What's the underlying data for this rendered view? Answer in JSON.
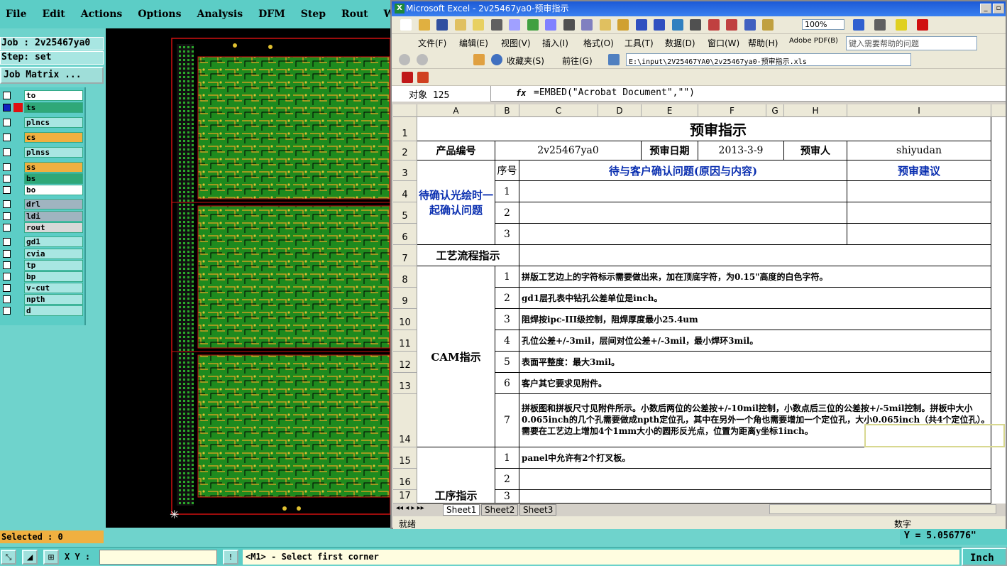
{
  "cam": {
    "menu": [
      "File",
      "Edit",
      "Actions",
      "Options",
      "Analysis",
      "DFM",
      "Step",
      "Rout",
      "Windows"
    ],
    "job": "Job : 2v25467ya0",
    "step": "Step: set",
    "job_matrix": "Job Matrix ...",
    "layers": [
      {
        "name": "to",
        "color": "#ffffff",
        "swatch": ""
      },
      {
        "name": "ts",
        "color": "#2fa878",
        "swatch": "#e01010"
      },
      {
        "name": "plncs",
        "color": "#a8e6e2",
        "swatch": ""
      },
      {
        "name": "cs",
        "color": "#f0b040",
        "swatch": ""
      },
      {
        "name": "plnss",
        "color": "#a8e6e2",
        "swatch": ""
      },
      {
        "name": "ss",
        "color": "#f0b040",
        "swatch": ""
      },
      {
        "name": "bs",
        "color": "#2fa878",
        "swatch": ""
      },
      {
        "name": "bo",
        "color": "#ffffff",
        "swatch": ""
      },
      {
        "name": "drl",
        "color": "#a0b4c0",
        "swatch": ""
      },
      {
        "name": "ldi",
        "color": "#a0b4c0",
        "swatch": ""
      },
      {
        "name": "rout",
        "color": "#d8d8d8",
        "swatch": ""
      },
      {
        "name": "gd1",
        "color": "#a8e6e2",
        "swatch": ""
      },
      {
        "name": "cvia",
        "color": "#a8e6e2",
        "swatch": ""
      },
      {
        "name": "tp",
        "color": "#a8e6e2",
        "swatch": ""
      },
      {
        "name": "bp",
        "color": "#a8e6e2",
        "swatch": ""
      },
      {
        "name": "v-cut",
        "color": "#a8e6e2",
        "swatch": ""
      },
      {
        "name": "npth",
        "color": "#a8e6e2",
        "swatch": ""
      },
      {
        "name": "d",
        "color": "#a8e6e2",
        "swatch": ""
      }
    ],
    "selected": "Selected : 0",
    "xy_label": "X Y :",
    "message": "<M1> - Select first corner",
    "units": "Inch",
    "y_readout": "Y = 5.056776\""
  },
  "excel": {
    "title": "Microsoft Excel - 2v25467ya0-预审指示",
    "menu": [
      "文件(F)",
      "编辑(E)",
      "视图(V)",
      "插入(I)",
      "格式(O)",
      "工具(T)",
      "数据(D)",
      "窗口(W)",
      "帮助(H)",
      "Adobe PDF(B)"
    ],
    "help_box": "键入需要帮助的问题",
    "zoom": "100%",
    "favorites": "收藏夹(S)",
    "goto": "前往(G)",
    "path": "E:\\input\\2V25467YA0\\2v25467ya0-预审指示.xls",
    "name_box": "对象 125",
    "formula": "=EMBED(\"Acrobat Document\",\"\")",
    "columns": [
      "A",
      "B",
      "C",
      "D",
      "E",
      "F",
      "G",
      "H",
      "I"
    ],
    "sheet": {
      "title": "预审指示",
      "product_label": "产品编号",
      "product_value": "2v25467ya0",
      "date_label": "预审日期",
      "date_value": "2013-3-9",
      "reviewer_label": "预审人",
      "reviewer_value": "shiyudan",
      "seq_label": "序号",
      "question_header": "待与客户确认问题(原因与内容)",
      "suggest_header": "预审建议",
      "confirm_label": "待确认光绘时一起确认问题",
      "process_label": "工艺流程指示",
      "cam_label": "CAM指示",
      "proc_label": "工序指示",
      "seq": [
        "1",
        "2",
        "3"
      ],
      "cam_items": [
        {
          "n": "1",
          "t": "拼版工艺边上的字符标示需要做出来，加在顶底字符，为0.15\"高度的白色字符。"
        },
        {
          "n": "2",
          "t": "gd1层孔表中钻孔公差单位是inch。"
        },
        {
          "n": "3",
          "t": "阻焊按ipc-III级控制，阻焊厚度最小25.4um"
        },
        {
          "n": "4",
          "t": "孔位公差+/-3mil，层间对位公差+/-3mil，最小焊环3mil。"
        },
        {
          "n": "5",
          "t": "表面平整度：最大3mil。"
        },
        {
          "n": "6",
          "t": "客户其它要求见附件。"
        },
        {
          "n": "7",
          "t": "拼板图和拼板尺寸见附件所示。小数后两位的公差按+/-10mil控制，小数点后三位的公差按+/-5mil控制。拼板中大小0.065inch的几个孔需要做成npth定位孔，其中在另外一个角也需要增加一个定位孔，大小0.065inch（共4个定位孔）。需要在工艺边上增加4个1mm大小的圆形反光点，位置为距离y坐标1inch。"
        }
      ],
      "proc_items": [
        {
          "n": "1",
          "t": "panel中允许有2个打叉板。"
        },
        {
          "n": "2",
          "t": ""
        },
        {
          "n": "3",
          "t": ""
        }
      ],
      "row_numbers": [
        "1",
        "2",
        "3",
        "4",
        "5",
        "6",
        "7",
        "8",
        "9",
        "10",
        "11",
        "12",
        "13",
        "14",
        "15",
        "16",
        "17"
      ]
    },
    "tabs": [
      "Sheet1",
      "Sheet2",
      "Sheet3"
    ],
    "status_left": "就绪",
    "status_right": "数字"
  }
}
